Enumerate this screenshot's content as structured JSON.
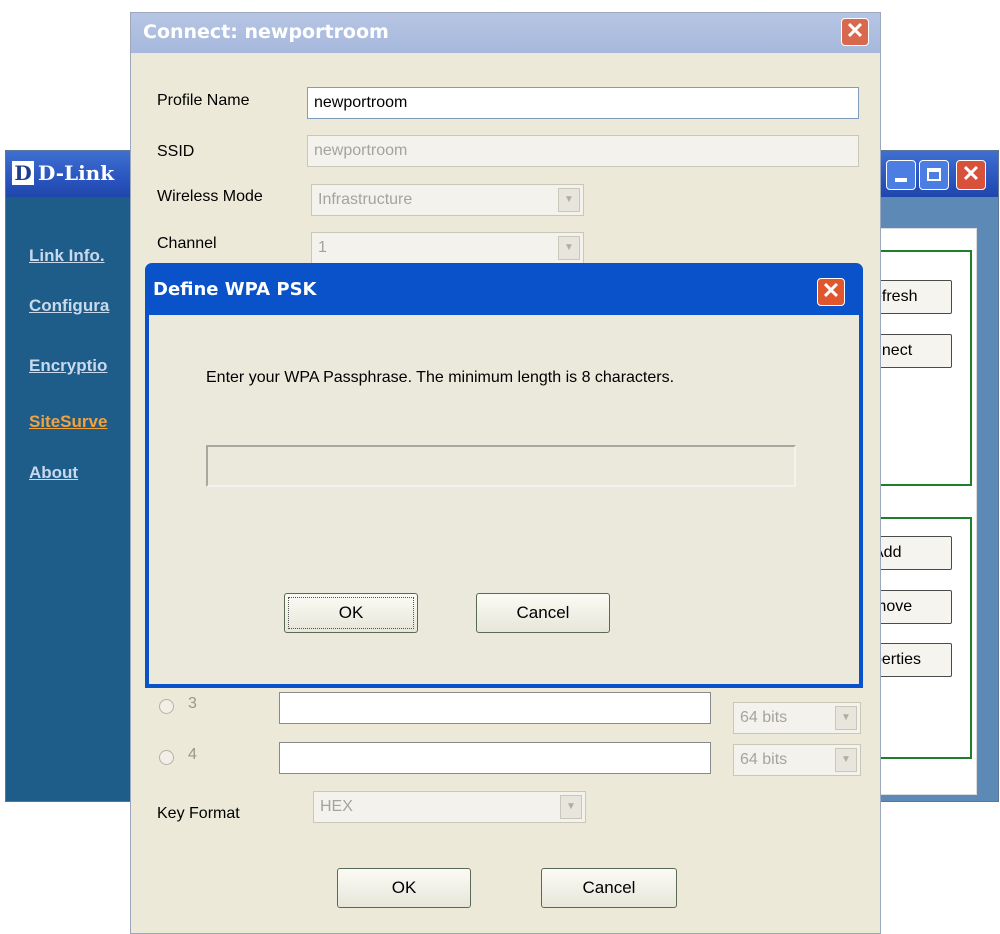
{
  "dlink_window": {
    "title": "D-Link",
    "logo_letter": "D",
    "nav": [
      "Link Info.",
      "Configura",
      "Encryptio",
      "SiteSurve",
      "About"
    ],
    "active_nav_index": 3,
    "buttons": [
      "efresh",
      "nnect",
      "Add",
      "move",
      "perties"
    ]
  },
  "connect_dialog": {
    "title": "Connect: newportroom",
    "profile_name_label": "Profile Name",
    "profile_name_value": "newportroom",
    "ssid_label": "SSID",
    "ssid_value": "newportroom",
    "wireless_mode_label": "Wireless Mode",
    "wireless_mode_value": "Infrastructure",
    "channel_label": "Channel",
    "channel_value": "1",
    "key_rows": [
      {
        "label": "3",
        "bits": "64 bits"
      },
      {
        "label": "4",
        "bits": "64 bits"
      }
    ],
    "key_format_label": "Key Format",
    "key_format_value": "HEX",
    "ok_label": "OK",
    "cancel_label": "Cancel"
  },
  "wpa_dialog": {
    "title": "Define WPA PSK",
    "message": "Enter your WPA Passphrase.  The minimum length is 8 characters.",
    "passphrase_value": "",
    "ok_label": "OK",
    "cancel_label": "Cancel"
  },
  "colors": {
    "xp_blue": "#0a52c9",
    "dialog_bg": "#ece9d8",
    "nav_active": "#f2a23c",
    "group_border": "#1d7f2a"
  }
}
